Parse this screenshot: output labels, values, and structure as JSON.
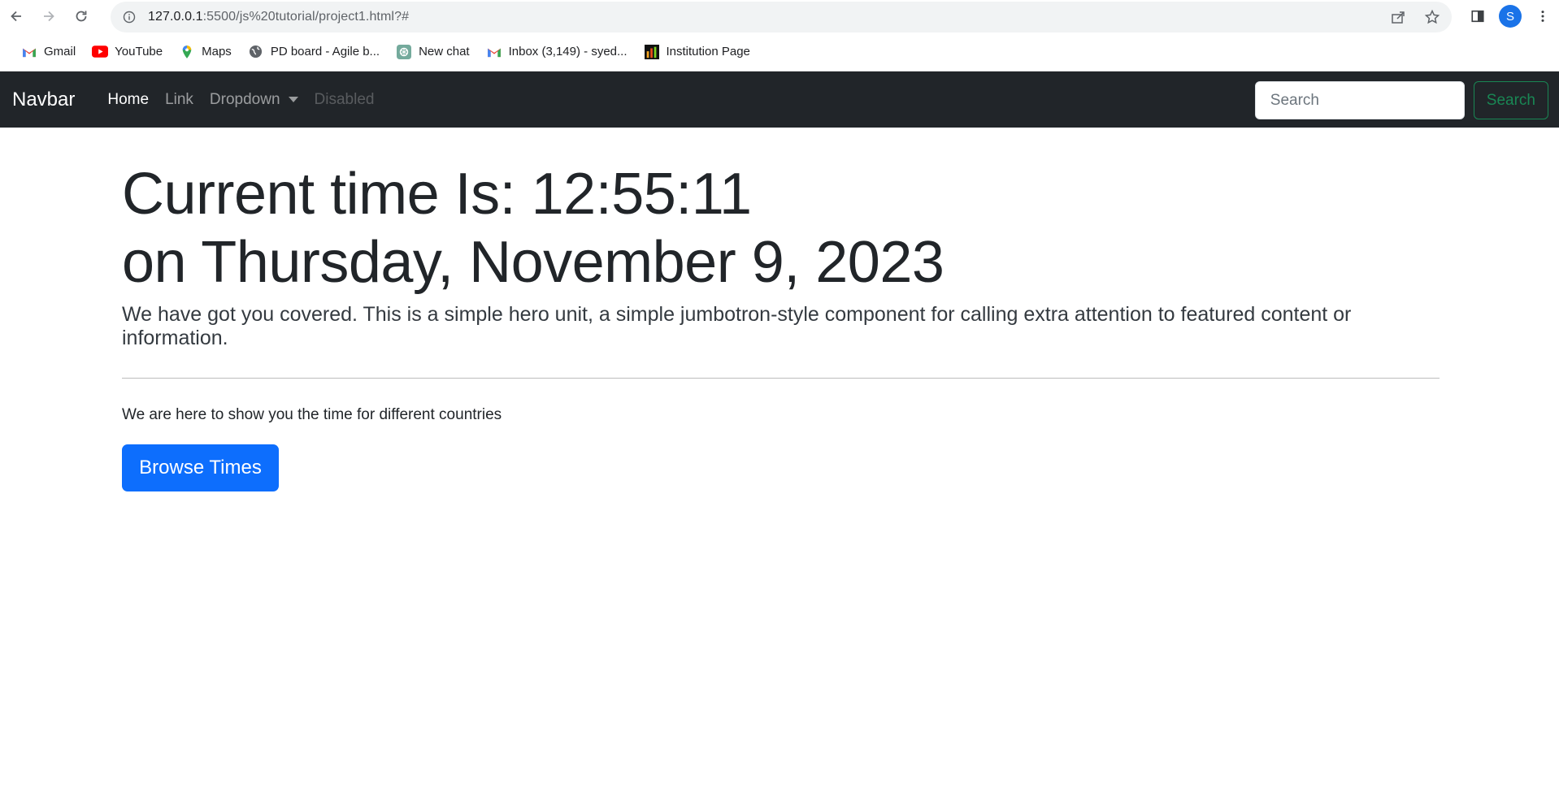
{
  "browser": {
    "url_host": "127.0.0.1",
    "url_path": ":5500/js%20tutorial/project1.html?#",
    "profile_initial": "S",
    "bookmarks": [
      {
        "label": "Gmail",
        "icon": "gmail-icon"
      },
      {
        "label": "YouTube",
        "icon": "youtube-icon"
      },
      {
        "label": "Maps",
        "icon": "maps-icon"
      },
      {
        "label": "PD board - Agile b...",
        "icon": "globe-icon"
      },
      {
        "label": "New chat",
        "icon": "chatgpt-icon"
      },
      {
        "label": "Inbox (3,149) - syed...",
        "icon": "gmail-icon"
      },
      {
        "label": "Institution Page",
        "icon": "bar-chart-icon"
      }
    ]
  },
  "navbar": {
    "brand": "Navbar",
    "links": [
      "Home",
      "Link",
      "Dropdown",
      "Disabled"
    ],
    "search_placeholder": "Search",
    "search_button": "Search"
  },
  "hero": {
    "time_line": "Current time Is: 12:55:11",
    "date_line": "on Thursday, November 9, 2023",
    "lead": "We have got you covered. This is a simple hero unit, a simple jumbotron-style component for calling extra attention to featured content or information.",
    "subtext": "We are here to show you the time for different countries",
    "button": "Browse Times"
  },
  "colors": {
    "navbar_bg": "#212529",
    "primary": "#0d6efd",
    "success": "#198754"
  }
}
